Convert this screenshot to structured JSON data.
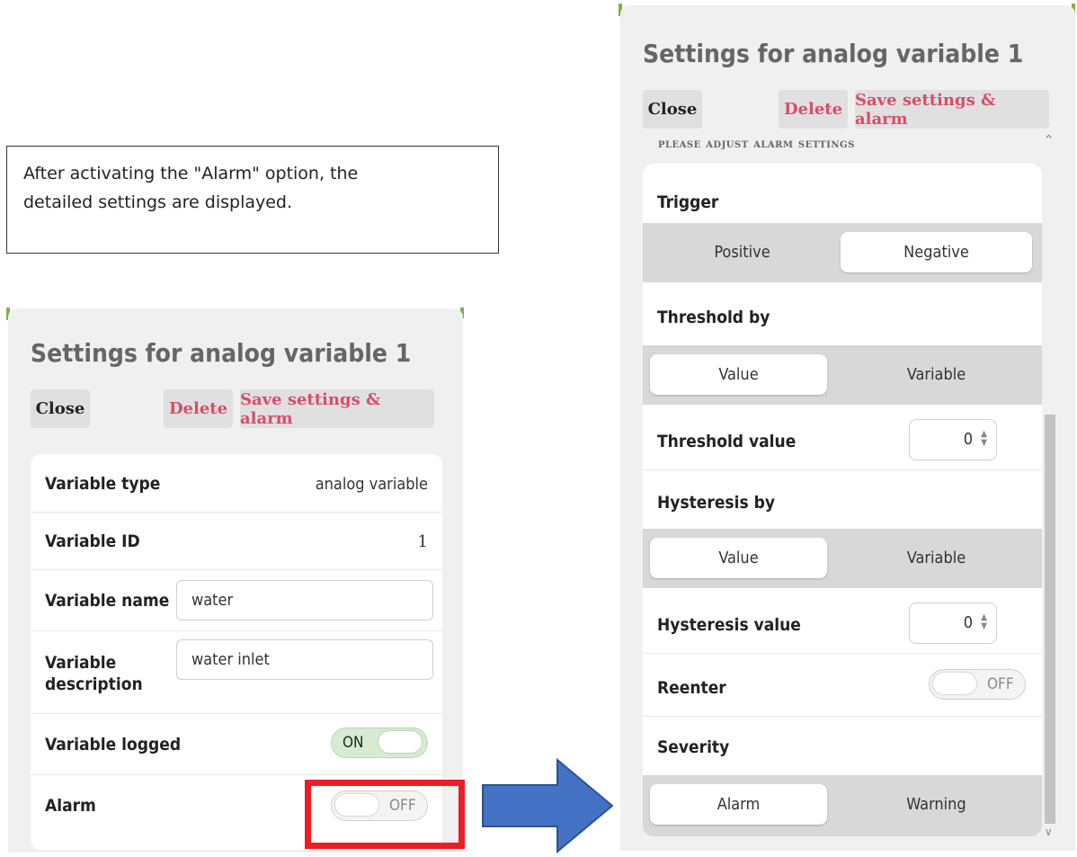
{
  "note": {
    "line1": "After activating the \"Alarm\" option, the",
    "line2": "detailed settings are displayed."
  },
  "left": {
    "title": "Settings for analog variable 1",
    "close": "Close",
    "delete": "Delete",
    "save": "Save settings & alarm",
    "rows": {
      "type_label": "Variable type",
      "type_value": "analog variable",
      "id_label": "Variable ID",
      "id_value": "1",
      "name_label": "Variable name",
      "name_value": "water",
      "desc_label1": "Variable",
      "desc_label2": "description",
      "desc_value": "water inlet",
      "logged_label": "Variable logged",
      "logged_state": "ON",
      "alarm_label": "Alarm",
      "alarm_state": "OFF"
    }
  },
  "right": {
    "title": "Settings for analog variable 1",
    "close": "Close",
    "delete": "Delete",
    "save": "Save settings & alarm",
    "section": "Please adjust alarm settings",
    "trigger_label": "Trigger",
    "trigger_opts": [
      "Positive",
      "Negative"
    ],
    "threshold_by_label": "Threshold by",
    "threshold_by_opts": [
      "Value",
      "Variable"
    ],
    "threshold_value_label": "Threshold value",
    "threshold_value": "0",
    "hysteresis_by_label": "Hysteresis by",
    "hysteresis_by_opts": [
      "Value",
      "Variable"
    ],
    "hysteresis_value_label": "Hysteresis value",
    "hysteresis_value": "0",
    "reenter_label": "Reenter",
    "reenter_state": "OFF",
    "severity_label": "Severity",
    "severity_opts": [
      "Alarm",
      "Warning"
    ]
  },
  "colors": {
    "accent_red": "#d94d68",
    "highlight_box": "#ee1c24",
    "arrow": "#4472c4",
    "toggle_on": "#d6ecd2"
  }
}
